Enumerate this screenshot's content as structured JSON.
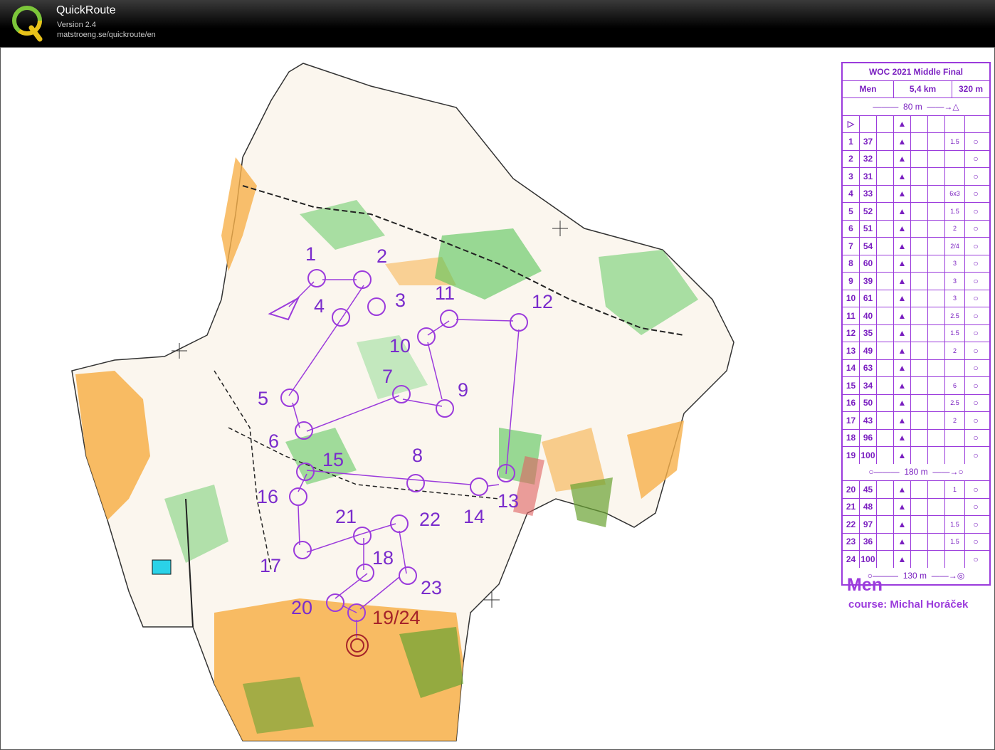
{
  "app": {
    "name": "QuickRoute",
    "version": "Version 2.4",
    "url": "matstroeng.se/quickroute/en"
  },
  "colors": {
    "course": "#9b3bdc",
    "open_land": "#f7b04a",
    "forest_green": "#56c556",
    "finish": "#a5232a"
  },
  "map_labels": [
    "1",
    "2",
    "3",
    "4",
    "5",
    "6",
    "7",
    "8",
    "9",
    "10",
    "11",
    "12",
    "13",
    "14",
    "15",
    "16",
    "17",
    "18",
    "20",
    "21",
    "22",
    "23",
    "19/24"
  ],
  "description": {
    "title": "WOC 2021 Middle Final",
    "class": "Men",
    "length": "5,4 km",
    "climb": "320 m",
    "start_leg": "80 m",
    "mid_leg": "180 m",
    "finish_leg": "130 m",
    "controls": [
      {
        "n": "1",
        "code": "37",
        "dim": "1.5"
      },
      {
        "n": "2",
        "code": "32",
        "dim": ""
      },
      {
        "n": "3",
        "code": "31",
        "dim": ""
      },
      {
        "n": "4",
        "code": "33",
        "dim": "6x3"
      },
      {
        "n": "5",
        "code": "52",
        "dim": "1.5"
      },
      {
        "n": "6",
        "code": "51",
        "dim": "2"
      },
      {
        "n": "7",
        "code": "54",
        "dim": "2/4"
      },
      {
        "n": "8",
        "code": "60",
        "dim": "3"
      },
      {
        "n": "9",
        "code": "39",
        "dim": "3"
      },
      {
        "n": "10",
        "code": "61",
        "dim": "3"
      },
      {
        "n": "11",
        "code": "40",
        "dim": "2.5"
      },
      {
        "n": "12",
        "code": "35",
        "dim": "1.5"
      },
      {
        "n": "13",
        "code": "49",
        "dim": "2"
      },
      {
        "n": "14",
        "code": "63",
        "dim": ""
      },
      {
        "n": "15",
        "code": "34",
        "dim": "6"
      },
      {
        "n": "16",
        "code": "50",
        "dim": "2.5"
      },
      {
        "n": "17",
        "code": "43",
        "dim": "2"
      },
      {
        "n": "18",
        "code": "96",
        "dim": ""
      },
      {
        "n": "19",
        "code": "100",
        "dim": ""
      },
      {
        "n": "20",
        "code": "45",
        "dim": "1"
      },
      {
        "n": "21",
        "code": "48",
        "dim": ""
      },
      {
        "n": "22",
        "code": "97",
        "dim": "1.5"
      },
      {
        "n": "23",
        "code": "36",
        "dim": "1.5"
      },
      {
        "n": "24",
        "code": "100",
        "dim": ""
      }
    ]
  },
  "course_title": "Men",
  "course_setter": "course: Michal Horáček"
}
